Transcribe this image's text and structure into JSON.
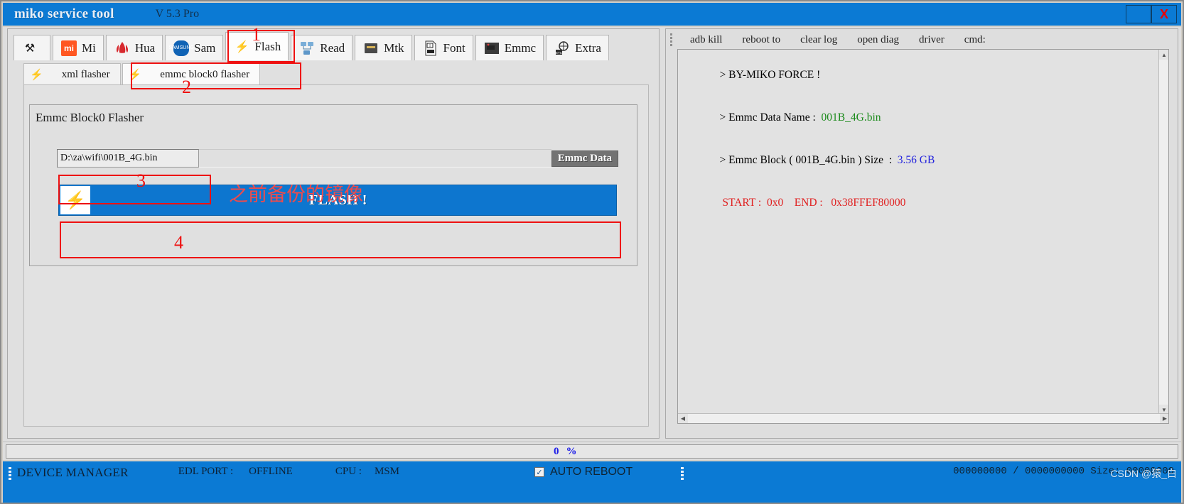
{
  "window": {
    "app_title": "miko service tool",
    "version": "V 5.3 Pro",
    "minimize_label": "",
    "close_label": "X"
  },
  "main_tabs": [
    {
      "label": "",
      "icon": "tools-icon",
      "active": false
    },
    {
      "label": "Mi",
      "icon": "xiaomi-icon",
      "active": false
    },
    {
      "label": "Hua",
      "icon": "huawei-icon",
      "active": false
    },
    {
      "label": "Sam",
      "icon": "samsung-icon",
      "active": false
    },
    {
      "label": "Flash",
      "icon": "lightning-icon",
      "active": true
    },
    {
      "label": "Read",
      "icon": "network-read-icon",
      "active": false
    },
    {
      "label": "Mtk",
      "icon": "chip-icon",
      "active": false
    },
    {
      "label": "Font",
      "icon": "ttf-file-icon",
      "active": false
    },
    {
      "label": "Emmc",
      "icon": "emmc-chip-icon",
      "active": false
    },
    {
      "label": "Extra",
      "icon": "gear-globe-icon",
      "active": false
    }
  ],
  "sub_tabs": [
    {
      "label": "xml flasher",
      "icon": "lightning-icon",
      "active": false
    },
    {
      "label": "emmc block0 flasher",
      "icon": "lightning-icon",
      "active": true
    }
  ],
  "flasher_panel": {
    "group_title": "Emmc Block0 Flasher",
    "path_value": "D:\\za\\wifi\\001B_4G.bin",
    "path_placeholder": "",
    "emmc_data_button": "Emmc Data",
    "flash_button": "FLASH !"
  },
  "log_toolbar": [
    {
      "label": "adb kill"
    },
    {
      "label": "reboot to"
    },
    {
      "label": "clear log"
    },
    {
      "label": "open diag"
    },
    {
      "label": "driver"
    },
    {
      "label": "cmd:"
    }
  ],
  "log": {
    "lines": [
      {
        "prefix": "> BY-MIKO FORCE !",
        "value": "",
        "value_color": ""
      },
      {
        "prefix": "> Emmc Data Name :  ",
        "value": "001B_4G.bin",
        "value_color": "green"
      },
      {
        "prefix": "> Emmc Block ( 001B_4G.bin ) Size  :  ",
        "value": "3.56 GB",
        "value_color": "blue"
      },
      {
        "prefix": " START :  0x0    END :   0x38FFEF80000",
        "value": "",
        "value_color": "red_all"
      }
    ]
  },
  "progress": {
    "value": "0",
    "unit": "%"
  },
  "statusbar": {
    "device_manager": "DEVICE MANAGER",
    "edl_port_label": "EDL PORT :",
    "edl_port_value": "OFFLINE",
    "cpu_label": "CPU :",
    "cpu_value": "MSM",
    "auto_reboot_label": "AUTO REBOOT",
    "auto_reboot_checked": "✓",
    "counter": "000000000 / 0000000000 Size: 00000000"
  },
  "watermark": "CSDN @猿_白",
  "annotations": {
    "n1": "1",
    "n2": "2",
    "n3": "3",
    "n4": "4",
    "chinese_note": "之前备份的镜像"
  },
  "colors": {
    "accent": "#0b7ad4",
    "flash_button": "#0d76cf",
    "annotation": "#ee1111"
  }
}
